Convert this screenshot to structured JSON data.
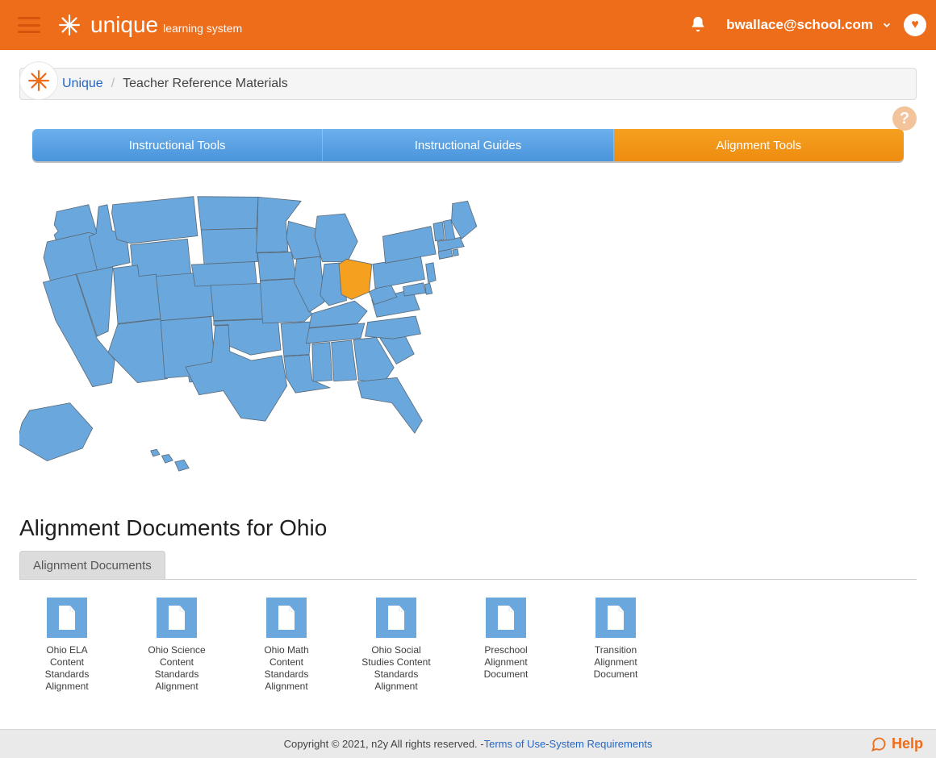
{
  "colors": {
    "brand": "#ed6d1b",
    "tab_blue": "#4a94dc",
    "tab_orange": "#ee8c10",
    "map_default": "#6aa7dc",
    "map_highlight": "#f6a020"
  },
  "header": {
    "brand_name": "unique",
    "brand_sub": "learning system",
    "user_email": "bwallace@school.com"
  },
  "breadcrumb": {
    "home": "Unique",
    "current": "Teacher Reference Materials"
  },
  "tabs": [
    {
      "label": "Instructional Tools",
      "active": false
    },
    {
      "label": "Instructional Guides",
      "active": false
    },
    {
      "label": "Alignment Tools",
      "active": true
    }
  ],
  "map": {
    "highlighted_state": "Ohio"
  },
  "page_title": "Alignment Documents for Ohio",
  "subtab_label": "Alignment Documents",
  "documents": [
    {
      "label": "Ohio ELA Content Standards Alignment"
    },
    {
      "label": "Ohio Science Content Standards Alignment"
    },
    {
      "label": "Ohio Math Content Standards Alignment"
    },
    {
      "label": "Ohio Social Studies Content Standards Alignment"
    },
    {
      "label": "Preschool Alignment Document"
    },
    {
      "label": "Transition Alignment Document"
    }
  ],
  "footer": {
    "copyright": "Copyright © 2021, n2y All rights reserved. - ",
    "terms": "Terms of Use",
    "sep": " - ",
    "sysreq": "System Requirements",
    "help": "Help"
  }
}
